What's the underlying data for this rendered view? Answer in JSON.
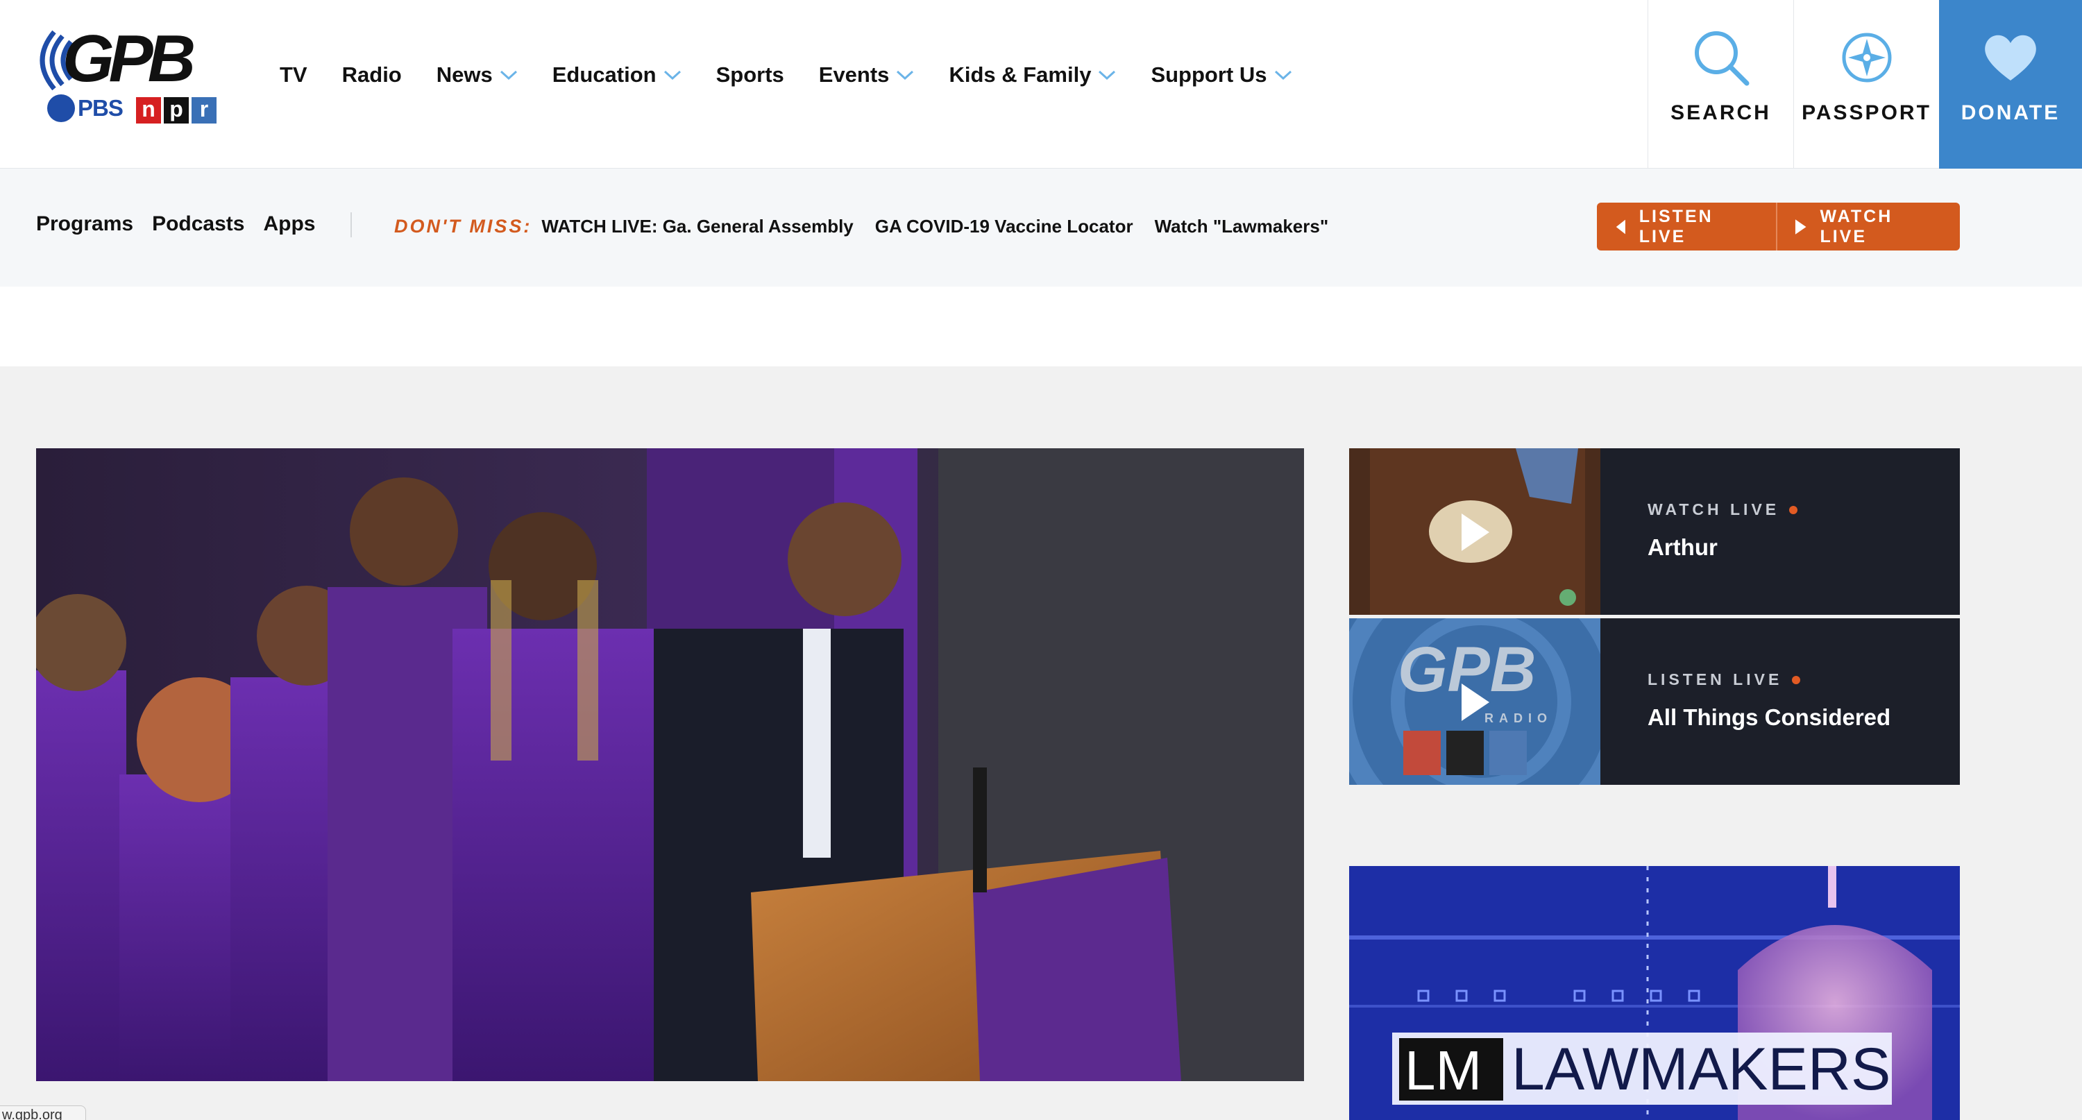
{
  "logo": {
    "text": "GPB",
    "partners": [
      "PBS",
      "n",
      "p",
      "r"
    ]
  },
  "nav": {
    "items": [
      {
        "label": "TV",
        "dropdown": false
      },
      {
        "label": "Radio",
        "dropdown": false
      },
      {
        "label": "News",
        "dropdown": true
      },
      {
        "label": "Education",
        "dropdown": true
      },
      {
        "label": "Sports",
        "dropdown": false
      },
      {
        "label": "Events",
        "dropdown": true
      },
      {
        "label": "Kids & Family",
        "dropdown": true
      },
      {
        "label": "Support Us",
        "dropdown": true
      }
    ]
  },
  "tools": {
    "search_label": "SEARCH",
    "passport_label": "PASSPORT",
    "donate_label": "DONATE"
  },
  "subnav": {
    "links": [
      "Programs",
      "Podcasts",
      "Apps"
    ],
    "dont_miss_label": "DON'T MISS:",
    "dont_miss_links": [
      "WATCH LIVE: Ga. General Assembly",
      "GA COVID-19 Vaccine Locator",
      "Watch \"Lawmakers\""
    ],
    "listen_live": "LISTEN LIVE",
    "watch_live": "WATCH LIVE"
  },
  "live_cards": [
    {
      "kicker": "WATCH LIVE",
      "show": "Arthur"
    },
    {
      "kicker": "LISTEN LIVE",
      "show": "All Things Considered",
      "thumb_text": "GPB",
      "thumb_sub": "RADIO"
    }
  ],
  "promo": {
    "title": "LAWMAKERS",
    "mark": "LM"
  },
  "status_url": "w.gpb.org",
  "colors": {
    "accent_orange": "#d35a1e",
    "donate_blue": "#3c86cb",
    "card_bg": "#1c1f29",
    "chevron_blue": "#6bb4e8"
  }
}
